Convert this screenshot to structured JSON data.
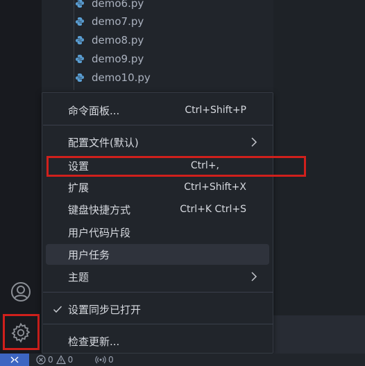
{
  "explorer": {
    "files": [
      {
        "name": "demo6.py",
        "icon": "python-file-icon"
      },
      {
        "name": "demo7.py",
        "icon": "python-file-icon"
      },
      {
        "name": "demo8.py",
        "icon": "python-file-icon"
      },
      {
        "name": "demo9.py",
        "icon": "python-file-icon"
      },
      {
        "name": "demo10.py",
        "icon": "python-file-icon"
      }
    ]
  },
  "menu": {
    "command_palette": {
      "label": "命令面板...",
      "shortcut": "Ctrl+Shift+P"
    },
    "profile": {
      "label": "配置文件(默认)"
    },
    "settings": {
      "label": "设置",
      "shortcut": "Ctrl+,"
    },
    "extensions": {
      "label": "扩展",
      "shortcut": "Ctrl+Shift+X"
    },
    "keyboard_shortcuts": {
      "label": "键盘快捷方式",
      "shortcut": "Ctrl+K Ctrl+S"
    },
    "user_snippets": {
      "label": "用户代码片段"
    },
    "user_tasks": {
      "label": "用户任务"
    },
    "themes": {
      "label": "主题"
    },
    "settings_sync": {
      "label": "设置同步已打开",
      "checked": true
    },
    "check_updates": {
      "label": "检查更新..."
    }
  },
  "status_bar": {
    "errors": "0",
    "warnings": "0",
    "ports": "0"
  },
  "colors": {
    "highlight_box": "#d0201c",
    "remote_button": "#3d66c2",
    "python_icon": "#5a9fd4"
  }
}
